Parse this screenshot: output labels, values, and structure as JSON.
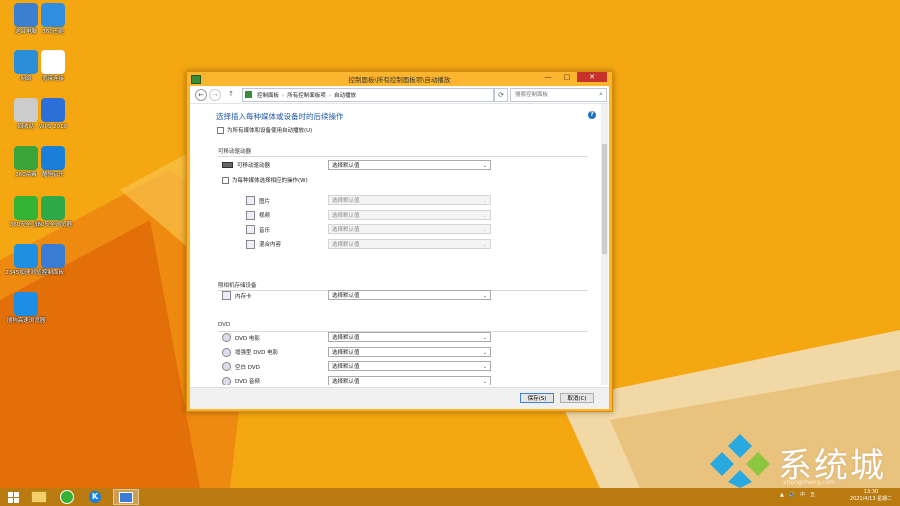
{
  "desktop": {
    "icons": [
      {
        "label": "这台电脑",
        "icon": "computer-icon",
        "color": "#3b7fd0"
      },
      {
        "label": "360压缩",
        "icon": "archive-icon",
        "color": "#2f8ee0"
      },
      {
        "label": "网络",
        "icon": "network-icon",
        "color": "#2a8fd8"
      },
      {
        "label": "宽带连接",
        "icon": "document-icon",
        "color": "#ffffff"
      },
      {
        "label": "回收站",
        "icon": "recycle-bin-icon",
        "color": "#cccccc"
      },
      {
        "label": "WPS 2019",
        "icon": "wps-icon",
        "color": "#2d6fd8"
      },
      {
        "label": "360杀毒",
        "icon": "shield-icon",
        "color": "#3aa33a"
      },
      {
        "label": "酷狗音乐",
        "icon": "kugou-icon",
        "color": "#1a7fd8"
      },
      {
        "label": "360安全卫士",
        "icon": "360-guard-icon",
        "color": "#33b233"
      },
      {
        "label": "360安全浏览器",
        "icon": "360-browser-icon",
        "color": "#2fa847"
      },
      {
        "label": "2345加速浏览器",
        "icon": "ie-browser-icon",
        "color": "#1e90e0"
      },
      {
        "label": "控制面板",
        "icon": "control-panel-icon",
        "color": "#3a7bd5"
      },
      {
        "label": "搜狗高速浏览器",
        "icon": "sogou-browser-icon",
        "color": "#1d8ee6"
      }
    ]
  },
  "window": {
    "title": "控制面板\\所有控制面板项\\自动播放",
    "buttons": {
      "minimize": "—",
      "maximize": "□",
      "close": "✕"
    },
    "nav": {
      "back": "←",
      "forward": "→",
      "up": "↑",
      "refresh": "⟳",
      "dropdown": "⌄"
    },
    "breadcrumbs": [
      "控制面板",
      "所有控制面板项",
      "自动播放"
    ],
    "search_placeholder": "搜索控制面板",
    "help": "?",
    "heading": "选择插入每种媒体或设备时的后续操作",
    "use_all_label": "为所有媒体和设备使用自动播放(U)",
    "use_all_checked": false,
    "sections": {
      "removable": {
        "title": "可移动驱动器",
        "drive_label": "可移动驱动器",
        "drive_value": "选择默认值",
        "per_type_label": "为每种媒体选择相应的操作(W)",
        "items": [
          {
            "label": "图片",
            "value": "选择默认值"
          },
          {
            "label": "视频",
            "value": "选择默认值"
          },
          {
            "label": "音乐",
            "value": "选择默认值"
          },
          {
            "label": "混合内容",
            "value": "选择默认值"
          }
        ]
      },
      "camera": {
        "title": "照相机存储设备",
        "items": [
          {
            "label": "内存卡",
            "value": "选择默认值"
          }
        ]
      },
      "dvd": {
        "title": "DVD",
        "items": [
          {
            "label": "DVD 电影",
            "value": "选择默认值"
          },
          {
            "label": "增强型 DVD 电影",
            "value": "选择默认值"
          },
          {
            "label": "空白 DVD",
            "value": "选择默认值"
          },
          {
            "label": "DVD 音频",
            "value": "选择默认值"
          }
        ]
      }
    },
    "save_label": "保存(S)",
    "cancel_label": "取消(C)"
  },
  "taskbar": {
    "tray": [
      "▲",
      "🔊",
      "中",
      "五"
    ],
    "time": "13:30",
    "date": "2021/4/13 星期二"
  },
  "watermark": {
    "text": "系统城",
    "url": "xitongcheng.com"
  },
  "colors": {
    "desktop": "#f5a712",
    "accent": "#1e5aa8",
    "window_frame": "#fbb52e",
    "close": "#c7312b"
  }
}
